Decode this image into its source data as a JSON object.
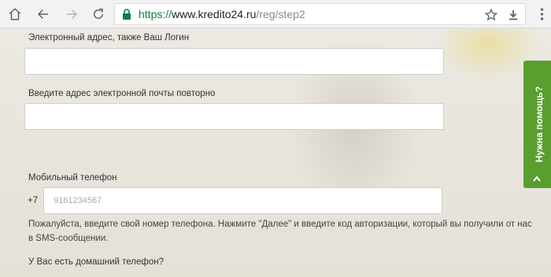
{
  "browser": {
    "url_protocol": "https://",
    "url_host": "www.kredito24.ru",
    "url_path": "/reg/step2"
  },
  "form": {
    "email_label": "Электронный адрес, также Ваш Логин",
    "email_value": "",
    "email_repeat_label": "Введите адрес электронной почты повторно",
    "email_repeat_value": "",
    "phone_label": "Мобильный телефон",
    "phone_prefix": "+7",
    "phone_placeholder": "9161234567",
    "phone_hint": "Пожалуйста, введите свой номер телефона. Нажмите \"Далее\" и введите код авторизации, который вы получили от нас в SMS-сообщении.",
    "home_phone_question": "У Вас есть домашний телефон?"
  },
  "help_tab": {
    "label": "Нужна помощь?"
  },
  "colors": {
    "accent_green": "#5a9e2f",
    "secure_green": "#0b8043"
  }
}
